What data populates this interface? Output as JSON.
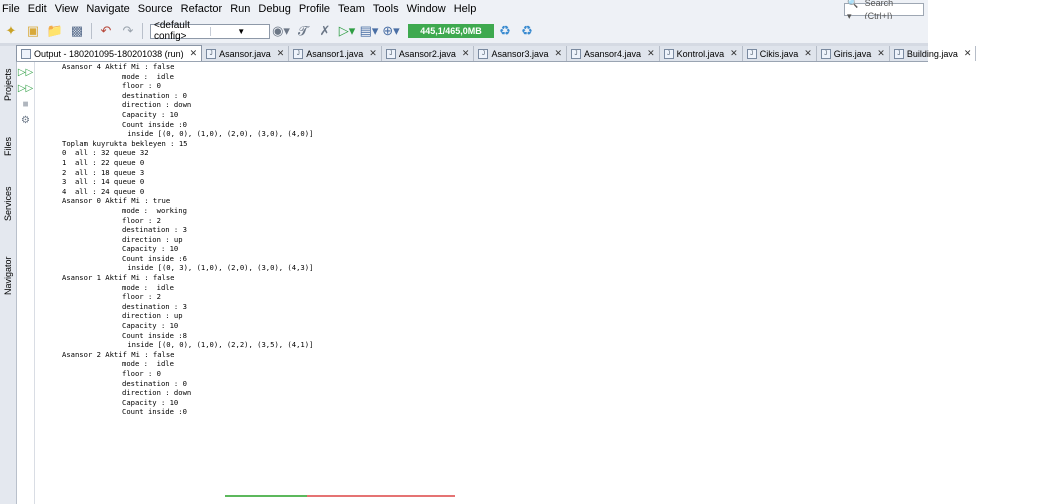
{
  "menubar": {
    "items": [
      "File",
      "Edit",
      "View",
      "Navigate",
      "Source",
      "Refactor",
      "Run",
      "Debug",
      "Profile",
      "Team",
      "Tools",
      "Window",
      "Help"
    ],
    "search_placeholder": "Search (Ctrl+I)"
  },
  "toolbar": {
    "config_value": "<default config>",
    "memory": "445,1/465,0MB"
  },
  "sidebar": {
    "tabs": [
      "Projects",
      "Files",
      "Services",
      "Navigator"
    ]
  },
  "tabs": [
    {
      "label": "Output - 180201095-180201038 (run)",
      "active": true
    },
    {
      "label": "Asansor.java",
      "active": false
    },
    {
      "label": "Asansor1.java",
      "active": false
    },
    {
      "label": "Asansor2.java",
      "active": false
    },
    {
      "label": "Asansor3.java",
      "active": false
    },
    {
      "label": "Asansor4.java",
      "active": false
    },
    {
      "label": "Kontrol.java",
      "active": false
    },
    {
      "label": "Cikis.java",
      "active": false
    },
    {
      "label": "Giris.java",
      "active": false
    },
    {
      "label": "Building.java",
      "active": false
    }
  ],
  "output": {
    "lines": [
      {
        "indent": 0,
        "text": "Asansor 4 Aktif Mi : false"
      },
      {
        "indent": 1,
        "text": "mode :  idle"
      },
      {
        "indent": 1,
        "text": "floor : 0"
      },
      {
        "indent": 1,
        "text": "destination : 0"
      },
      {
        "indent": 1,
        "text": "direction : down"
      },
      {
        "indent": 1,
        "text": "Capacity : 10"
      },
      {
        "indent": 1,
        "text": "Count inside :0"
      },
      {
        "indent": 2,
        "text": " inside [(0, 0), (1,0), (2,0), (3,0), (4,0)]"
      },
      {
        "indent": 0,
        "text": "Toplam kuyrukta bekleyen : 15"
      },
      {
        "indent": 0,
        "text": "0  all : 32 queue 32"
      },
      {
        "indent": 0,
        "text": "1  all : 22 queue 0"
      },
      {
        "indent": 0,
        "text": "2  all : 18 queue 3"
      },
      {
        "indent": 0,
        "text": "3  all : 14 queue 0"
      },
      {
        "indent": 0,
        "text": "4  all : 24 queue 0"
      },
      {
        "indent": 0,
        "text": "Asansor 0 Aktif Mi : true"
      },
      {
        "indent": 1,
        "text": "mode :  working"
      },
      {
        "indent": 1,
        "text": "floor : 2"
      },
      {
        "indent": 1,
        "text": "destination : 3"
      },
      {
        "indent": 1,
        "text": "direction : up"
      },
      {
        "indent": 1,
        "text": "Capacity : 10"
      },
      {
        "indent": 1,
        "text": "Count inside :6"
      },
      {
        "indent": 2,
        "text": " inside [(0, 3), (1,0), (2,0), (3,0), (4,3)]"
      },
      {
        "indent": 0,
        "text": "Asansor 1 Aktif Mi : false"
      },
      {
        "indent": 1,
        "text": "mode :  idle"
      },
      {
        "indent": 1,
        "text": "floor : 2"
      },
      {
        "indent": 1,
        "text": "destination : 3"
      },
      {
        "indent": 1,
        "text": "direction : up"
      },
      {
        "indent": 1,
        "text": "Capacity : 10"
      },
      {
        "indent": 1,
        "text": "Count inside :8"
      },
      {
        "indent": 2,
        "text": " inside [(0, 0), (1,0), (2,2), (3,5), (4,1)]"
      },
      {
        "indent": 0,
        "text": "Asansor 2 Aktif Mi : false"
      },
      {
        "indent": 1,
        "text": "mode :  idle"
      },
      {
        "indent": 1,
        "text": "floor : 0"
      },
      {
        "indent": 1,
        "text": "destination : 0"
      },
      {
        "indent": 1,
        "text": "direction : down"
      },
      {
        "indent": 1,
        "text": "Capacity : 10"
      },
      {
        "indent": 1,
        "text": "Count inside :0"
      }
    ]
  },
  "colors": {
    "memory_bar": "#3ea94f",
    "chrome_bg": "#e9ecf2",
    "output_bg": "#ffffff"
  }
}
